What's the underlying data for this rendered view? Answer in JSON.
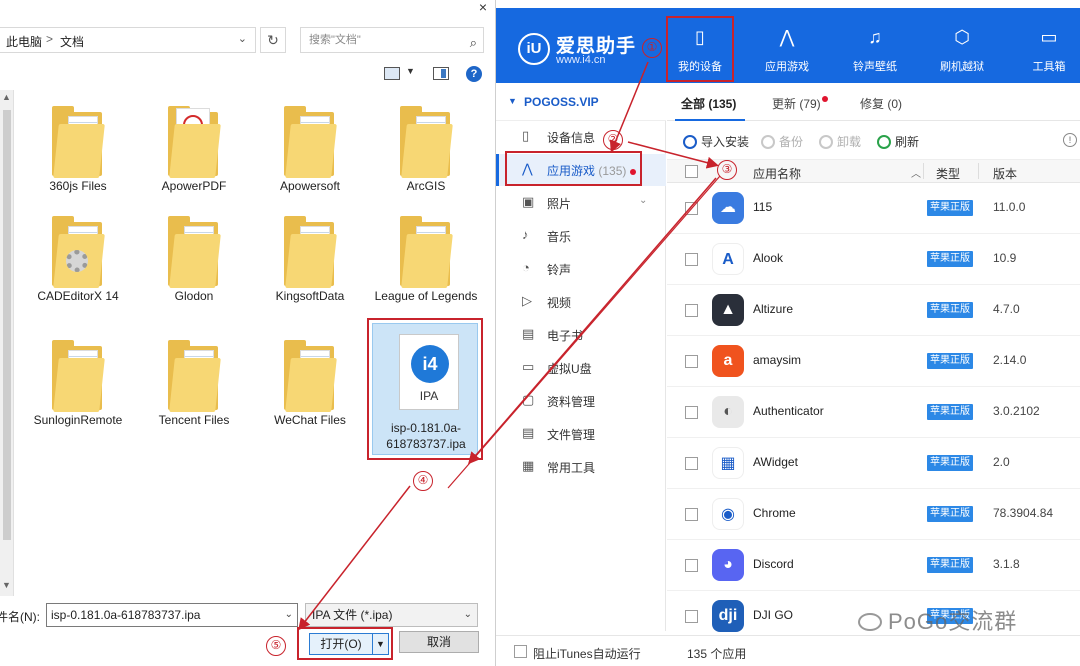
{
  "dialog": {
    "close": "×",
    "breadcrumb": [
      "此电脑",
      "文档"
    ],
    "breadcrumb_sep": ">",
    "search_placeholder": "搜索\"文档\"",
    "help": "?",
    "files": [
      {
        "name": "360js Files",
        "kind": "folder"
      },
      {
        "name": "ApowerPDF",
        "kind": "pdf-folder"
      },
      {
        "name": "Apowersoft",
        "kind": "folder"
      },
      {
        "name": "ArcGIS",
        "kind": "folder"
      },
      {
        "name": "CADEditorX 14",
        "kind": "gear-folder"
      },
      {
        "name": "Glodon",
        "kind": "folder"
      },
      {
        "name": "KingsoftData",
        "kind": "folder"
      },
      {
        "name": "League of Legends",
        "kind": "folder"
      },
      {
        "name": "SunloginRemote",
        "kind": "folder"
      },
      {
        "name": "Tencent Files",
        "kind": "folder"
      },
      {
        "name": "WeChat Files",
        "kind": "folder"
      }
    ],
    "ipa_file": {
      "name": "isp-0.181.0a-618783737.ipa",
      "icon_text": "IPA",
      "logo": "i4"
    },
    "filename_label": "文件名(N):",
    "filename_value": "isp-0.181.0a-618783737.ipa",
    "filetype_value": "IPA 文件 (*.ipa)",
    "open_label": "打开(O)",
    "cancel_label": "取消"
  },
  "app": {
    "logo_name": "爱思助手",
    "logo_url": "www.i4.cn",
    "nav": [
      {
        "label": "我的设备",
        "icon": "phone-icon"
      },
      {
        "label": "应用游戏",
        "icon": "appstore-icon"
      },
      {
        "label": "铃声壁纸",
        "icon": "music-icon"
      },
      {
        "label": "刷机越狱",
        "icon": "shield-icon"
      },
      {
        "label": "工具箱",
        "icon": "toolbox-icon"
      }
    ],
    "device_name": "POGOSS.VIP",
    "sidebar": [
      {
        "label": "设备信息",
        "icon": "device-info-icon"
      },
      {
        "label": "应用游戏",
        "count": "(135)",
        "icon": "appstore-icon"
      },
      {
        "label": "照片",
        "icon": "photo-icon"
      },
      {
        "label": "音乐",
        "icon": "music-note-icon"
      },
      {
        "label": "铃声",
        "icon": "bell-icon"
      },
      {
        "label": "视频",
        "icon": "video-icon"
      },
      {
        "label": "电子书",
        "icon": "book-icon"
      },
      {
        "label": "虚拟U盘",
        "icon": "usb-icon"
      },
      {
        "label": "资料管理",
        "icon": "folder-icon"
      },
      {
        "label": "文件管理",
        "icon": "file-icon"
      },
      {
        "label": "常用工具",
        "icon": "grid-icon"
      }
    ],
    "tabs": [
      {
        "label": "全部 (135)"
      },
      {
        "label": "更新 (79)"
      },
      {
        "label": "修复 (0)"
      }
    ],
    "actions": {
      "import": "导入安装",
      "backup": "备份",
      "uninstall": "卸载",
      "refresh": "刷新",
      "info": "!"
    },
    "columns": {
      "name": "应用名称",
      "type": "类型",
      "version": "版本"
    },
    "apps": [
      {
        "name": "115",
        "badge": "苹果正版",
        "version": "11.0.0",
        "color": "#3a7be0",
        "glyph": "☁"
      },
      {
        "name": "Alook",
        "badge": "苹果正版",
        "version": "10.9",
        "color": "#ffffff",
        "glyph": "A"
      },
      {
        "name": "Altizure",
        "badge": "苹果正版",
        "version": "4.7.0",
        "color": "#2a2f3a",
        "glyph": "▲"
      },
      {
        "name": "amaysim",
        "badge": "苹果正版",
        "version": "2.14.0",
        "color": "#f0531e",
        "glyph": "a"
      },
      {
        "name": "Authenticator",
        "badge": "苹果正版",
        "version": "3.0.2102",
        "color": "#e9e9e9",
        "glyph": "◐"
      },
      {
        "name": "AWidget",
        "badge": "苹果正版",
        "version": "2.0",
        "color": "#ffffff",
        "glyph": "▦"
      },
      {
        "name": "Chrome",
        "badge": "苹果正版",
        "version": "78.3904.84",
        "color": "#ffffff",
        "glyph": "◉"
      },
      {
        "name": "Discord",
        "badge": "苹果正版",
        "version": "3.1.8",
        "color": "#5865f2",
        "glyph": "◕"
      },
      {
        "name": "DJI GO",
        "badge": "苹果正版",
        "version": "",
        "color": "#1f5fb8",
        "glyph": "dji"
      }
    ],
    "footer_checkbox_label": "阻止iTunes自动运行",
    "footer_count": "135 个应用"
  },
  "annotations": [
    "①",
    "②",
    "③",
    "④",
    "⑤"
  ],
  "watermark": "PoGo交流群",
  "colors": {
    "brand": "#1669e0",
    "highlight": "#c8232c",
    "badge": "#2c88e6"
  }
}
